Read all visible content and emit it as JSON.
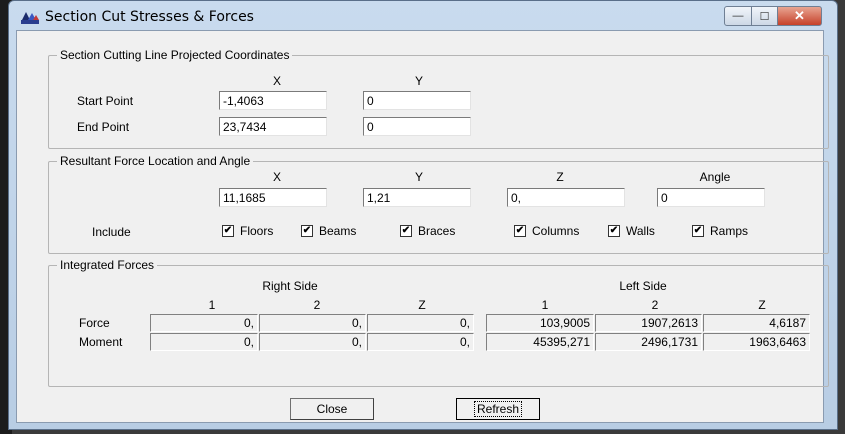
{
  "window": {
    "title": "Section Cut Stresses & Forces"
  },
  "titlebar_buttons": {
    "minimize": "—",
    "maximize": "☐",
    "close": "✕"
  },
  "projected": {
    "legend": "Section Cutting Line Projected Coordinates",
    "col_x": "X",
    "col_y": "Y",
    "start_label": "Start Point",
    "end_label": "End Point",
    "start_x": "-1,4063",
    "start_y": "0",
    "end_x": "23,7434",
    "end_y": "0"
  },
  "resultant": {
    "legend": "Resultant Force Location and Angle",
    "col_x": "X",
    "col_y": "Y",
    "col_z": "Z",
    "col_angle": "Angle",
    "x": "11,1685",
    "y": "1,21",
    "z": "0,",
    "angle": "0",
    "include_label": "Include",
    "checks": [
      {
        "label": "Floors",
        "checked": true
      },
      {
        "label": "Beams",
        "checked": true
      },
      {
        "label": "Braces",
        "checked": true
      },
      {
        "label": "Columns",
        "checked": true
      },
      {
        "label": "Walls",
        "checked": true
      },
      {
        "label": "Ramps",
        "checked": true
      }
    ]
  },
  "integrated": {
    "legend": "Integrated Forces",
    "right_side": "Right Side",
    "left_side": "Left Side",
    "cols": [
      "1",
      "2",
      "Z",
      "1",
      "2",
      "Z"
    ],
    "force_label": "Force",
    "moment_label": "Moment",
    "force": [
      "0,",
      "0,",
      "0,",
      "103,9005",
      "1907,2613",
      "4,6187"
    ],
    "moment": [
      "0,",
      "0,",
      "0,",
      "45395,271",
      "2496,1731",
      "1963,6463"
    ]
  },
  "buttons": {
    "close": "Close",
    "refresh": "Refresh"
  },
  "colors": {
    "client_bg": "#f0f0f0",
    "frame": "#c9dbee",
    "close_button": "#c6412a"
  }
}
